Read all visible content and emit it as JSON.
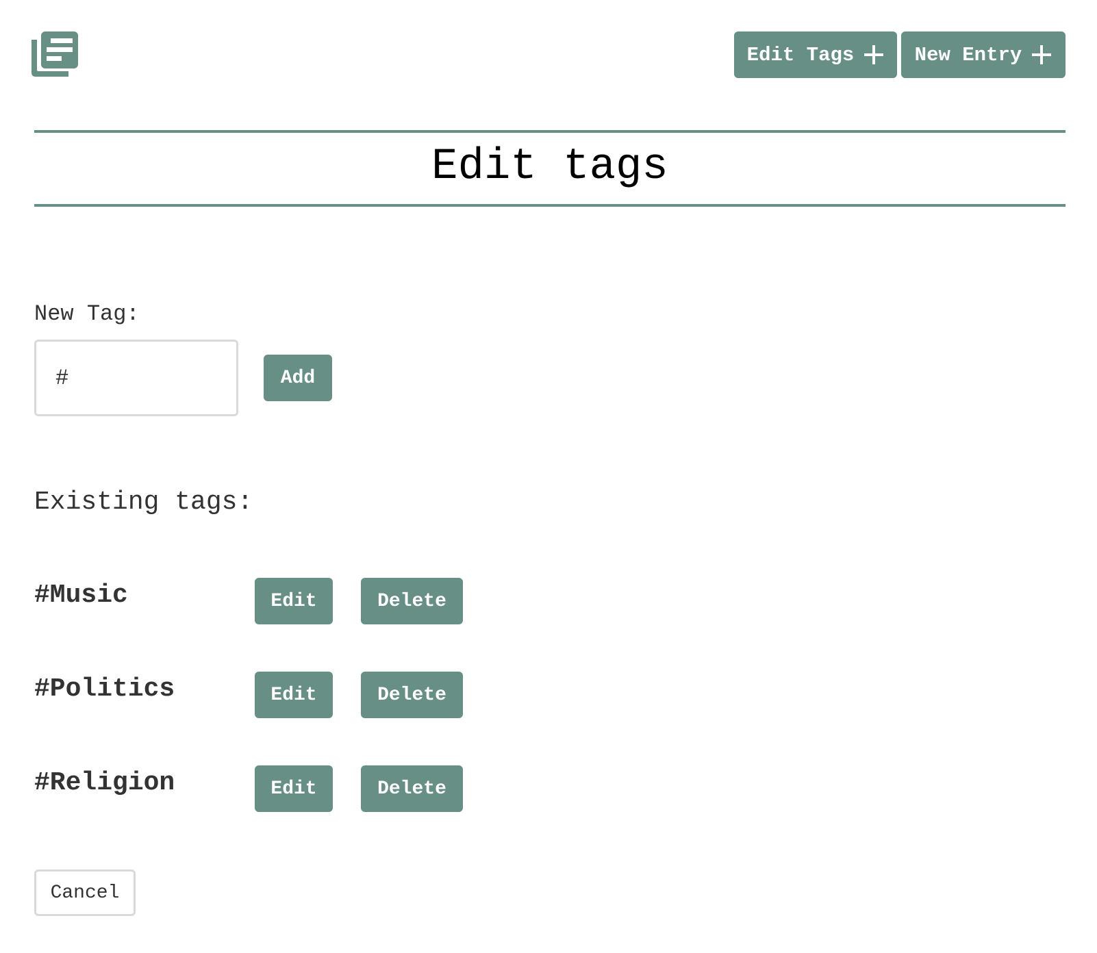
{
  "header": {
    "logo_icon": "journal-stack-icon",
    "edit_tags_label": "Edit Tags",
    "new_entry_label": "New Entry",
    "plus_icon": "plus-icon",
    "accent_color": "#678f86"
  },
  "page": {
    "title": "Edit tags"
  },
  "new_tag": {
    "label": "New Tag:",
    "placeholder": "#",
    "add_label": "Add"
  },
  "existing": {
    "label": "Existing tags:",
    "tags": [
      {
        "name": "#Music",
        "edit_label": "Edit",
        "delete_label": "Delete"
      },
      {
        "name": "#Politics",
        "edit_label": "Edit",
        "delete_label": "Delete"
      },
      {
        "name": "#Religion",
        "edit_label": "Edit",
        "delete_label": "Delete"
      }
    ]
  },
  "footer": {
    "cancel_label": "Cancel"
  }
}
